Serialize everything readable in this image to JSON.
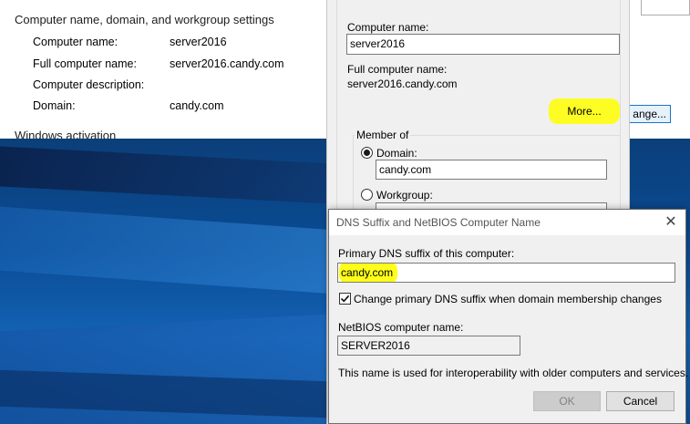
{
  "system": {
    "section_title": "Computer name, domain, and workgroup settings",
    "rows": [
      {
        "label": "Computer name:",
        "value": "server2016"
      },
      {
        "label": "Full computer name:",
        "value": "server2016.candy.com"
      },
      {
        "label": "Computer description:",
        "value": ""
      },
      {
        "label": "Domain:",
        "value": "candy.com"
      }
    ],
    "activation_title": "Windows activation",
    "change_button_partial": "ange..."
  },
  "computer_name_dialog": {
    "computer_name_label": "Computer name:",
    "computer_name_value": "server2016",
    "full_name_label": "Full computer name:",
    "full_name_value": "server2016.candy.com",
    "more_button": "More...",
    "member_of_label": "Member of",
    "domain_label": "Domain:",
    "domain_value": "candy.com",
    "workgroup_label": "Workgroup:",
    "selected": "Domain"
  },
  "dns_dialog": {
    "title": "DNS Suffix and NetBIOS Computer Name",
    "close_glyph": "✕",
    "primary_suffix_label": "Primary DNS suffix of this computer:",
    "primary_suffix_value": "candy.com",
    "change_suffix_checkbox_label": "Change primary DNS suffix when domain membership changes",
    "change_suffix_checked": true,
    "netbios_label": "NetBIOS computer name:",
    "netbios_value": "SERVER2016",
    "info_text": "This name is used for interoperability with older computers and services.",
    "ok_button": "OK",
    "cancel_button": "Cancel"
  },
  "colors": {
    "highlight": "#ffff00",
    "desktop_blue": "#0a4c95",
    "dialog_bg": "#f0f0f0"
  }
}
